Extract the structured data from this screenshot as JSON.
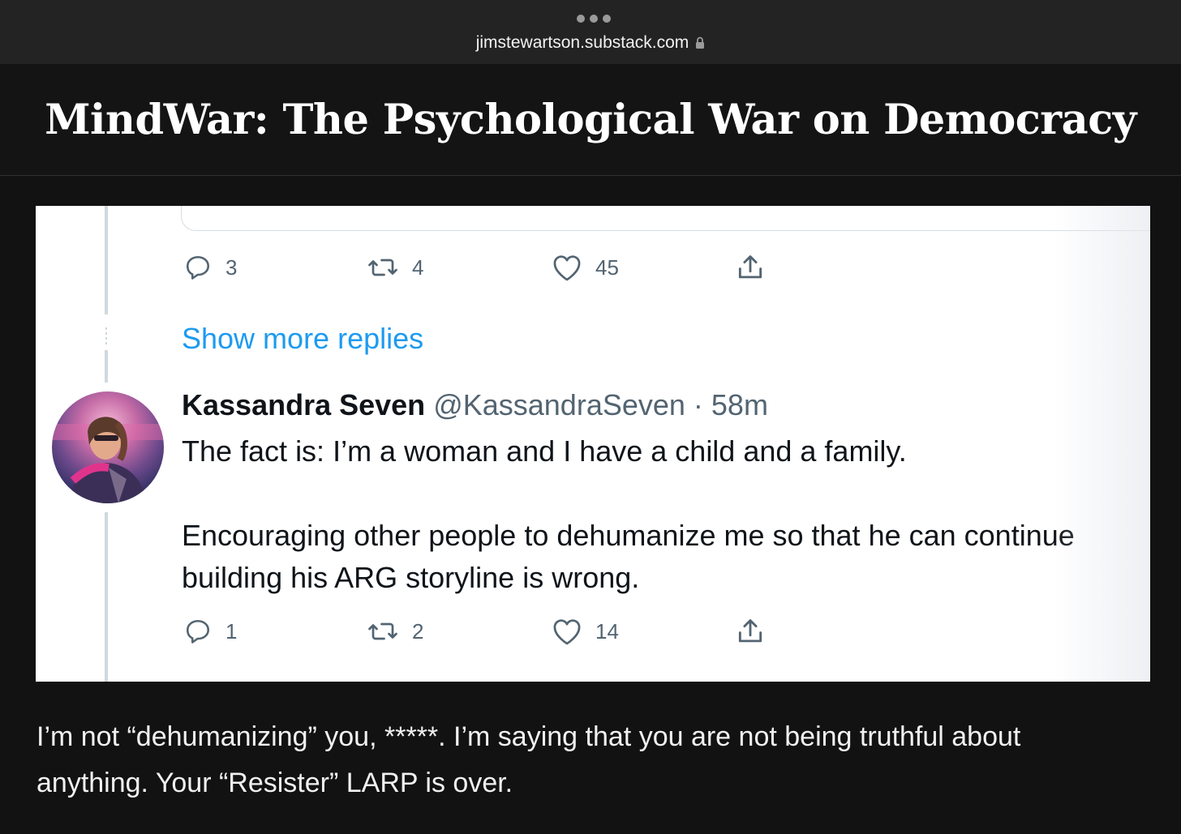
{
  "browser": {
    "url": "jimstewartson.substack.com"
  },
  "article": {
    "title": "MindWar: The Psychological War on Democracy",
    "paragraph": "I’m not “dehumanizing” you, *****. I’m saying that you are not being truthful about anything. Your “Resister” LARP is over."
  },
  "embed": {
    "previous_tweet_actions": {
      "replies": "3",
      "retweets": "4",
      "likes": "45"
    },
    "show_more_replies": "Show more replies",
    "tweet": {
      "author_name": "Kassandra Seven",
      "author_handle": "@KassandraSeven · 58m",
      "text_line1": "The fact is: I’m a woman and I have a child and a family.",
      "text_line2": "Encouraging other people to dehumanize me so that he can continue",
      "text_line3": "building his ARG storyline is wrong.",
      "replies": "1",
      "retweets": "2",
      "likes": "14"
    }
  },
  "colors": {
    "link_blue": "#1d9bf0",
    "muted_gray": "#536471"
  }
}
